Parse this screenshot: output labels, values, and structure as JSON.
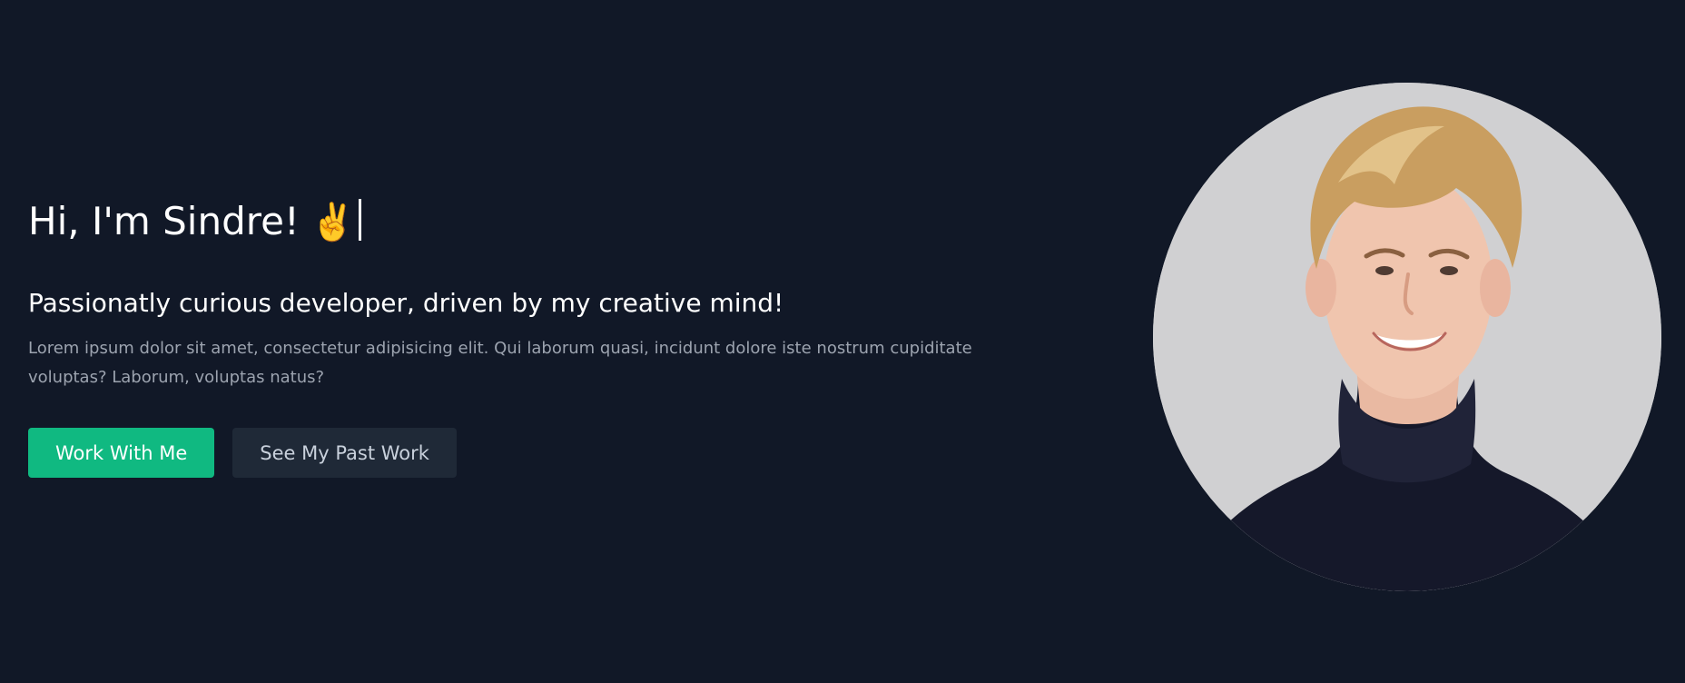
{
  "hero": {
    "greeting": "Hi, I'm Sindre!",
    "greeting_emoji": "✌️",
    "tagline": "Passionatly curious developer, driven by my creative mind!",
    "description": "Lorem ipsum dolor sit amet, consectetur adipisicing elit. Qui laborum quasi, incidunt dolore iste nostrum cupiditate voluptas? Laborum, voluptas natus?",
    "buttons": {
      "primary_label": "Work With Me",
      "secondary_label": "See My Past Work"
    }
  },
  "colors": {
    "background": "#111827",
    "primary_button": "#10b981",
    "secondary_button": "#1f2937"
  },
  "icons": {
    "greeting_emoji": "victory-hand-icon"
  }
}
